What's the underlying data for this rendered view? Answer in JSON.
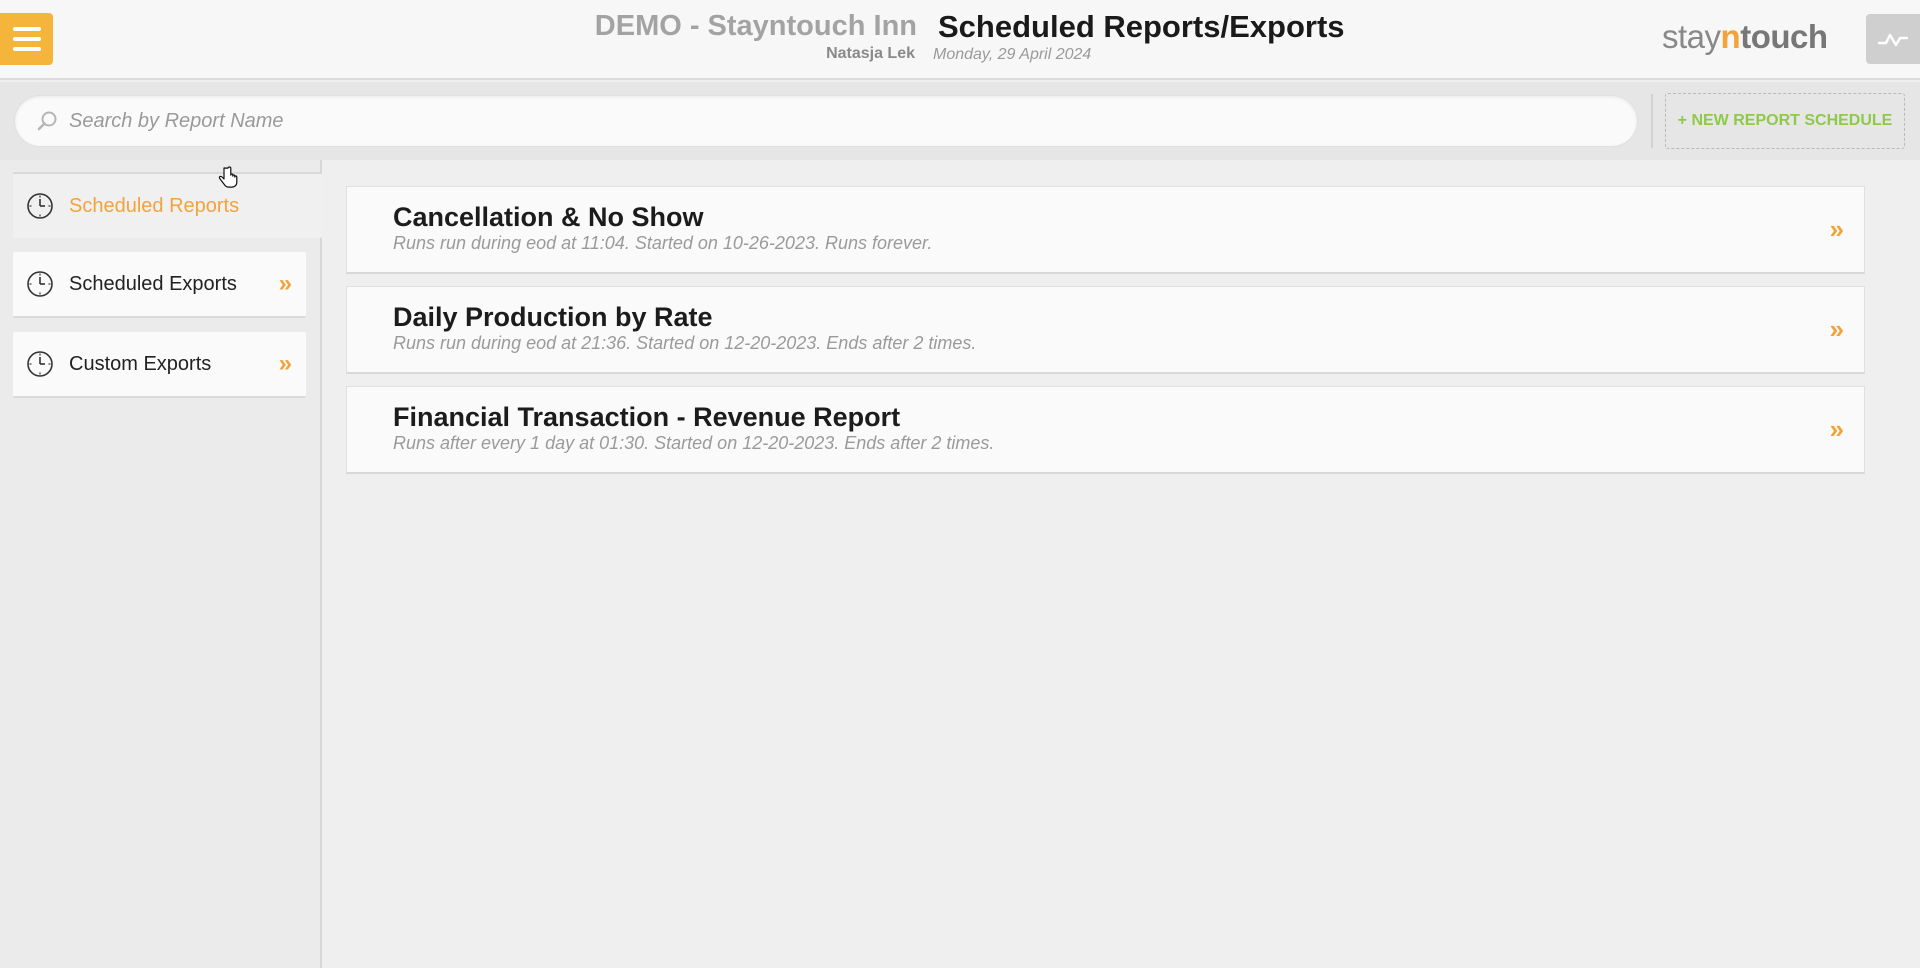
{
  "header": {
    "menu_icon": "hamburger-icon",
    "hotel_name": "DEMO - Stayntouch Inn",
    "user_name": "Natasja Lek",
    "page_title": "Scheduled Reports/Exports",
    "date": "Monday, 29 April 2024",
    "logo": {
      "stay": "stay",
      "n": "n",
      "touch": "touch"
    },
    "activity_icon": "activity-graph-icon"
  },
  "search": {
    "placeholder": "Search by Report Name",
    "value": "",
    "icon": "search-icon"
  },
  "new_schedule_button": "+ NEW REPORT SCHEDULE",
  "sidebar": {
    "items": [
      {
        "label": "Scheduled Reports",
        "icon": "clock-icon",
        "active": true
      },
      {
        "label": "Scheduled Exports",
        "icon": "clock-icon",
        "chevron": "»"
      },
      {
        "label": "Custom Exports",
        "icon": "clock-icon",
        "chevron": "»"
      }
    ]
  },
  "reports": [
    {
      "name": "Cancellation & No Show",
      "description": "Runs run during eod at 11:04. Started on 10-26-2023. Runs forever.",
      "chevron": "»"
    },
    {
      "name": "Daily Production by Rate",
      "description": "Runs run during eod at 21:36. Started on 12-20-2023. Ends after 2 times.",
      "chevron": "»"
    },
    {
      "name": "Financial Transaction - Revenue Report",
      "description": "Runs after every 1 day at 01:30. Started on 12-20-2023. Ends after 2 times.",
      "chevron": "»"
    }
  ],
  "colors": {
    "accent": "#f2a33a",
    "menu_button": "#f5b53a",
    "new_button_text": "#8fc94a",
    "background": "#efefef"
  }
}
